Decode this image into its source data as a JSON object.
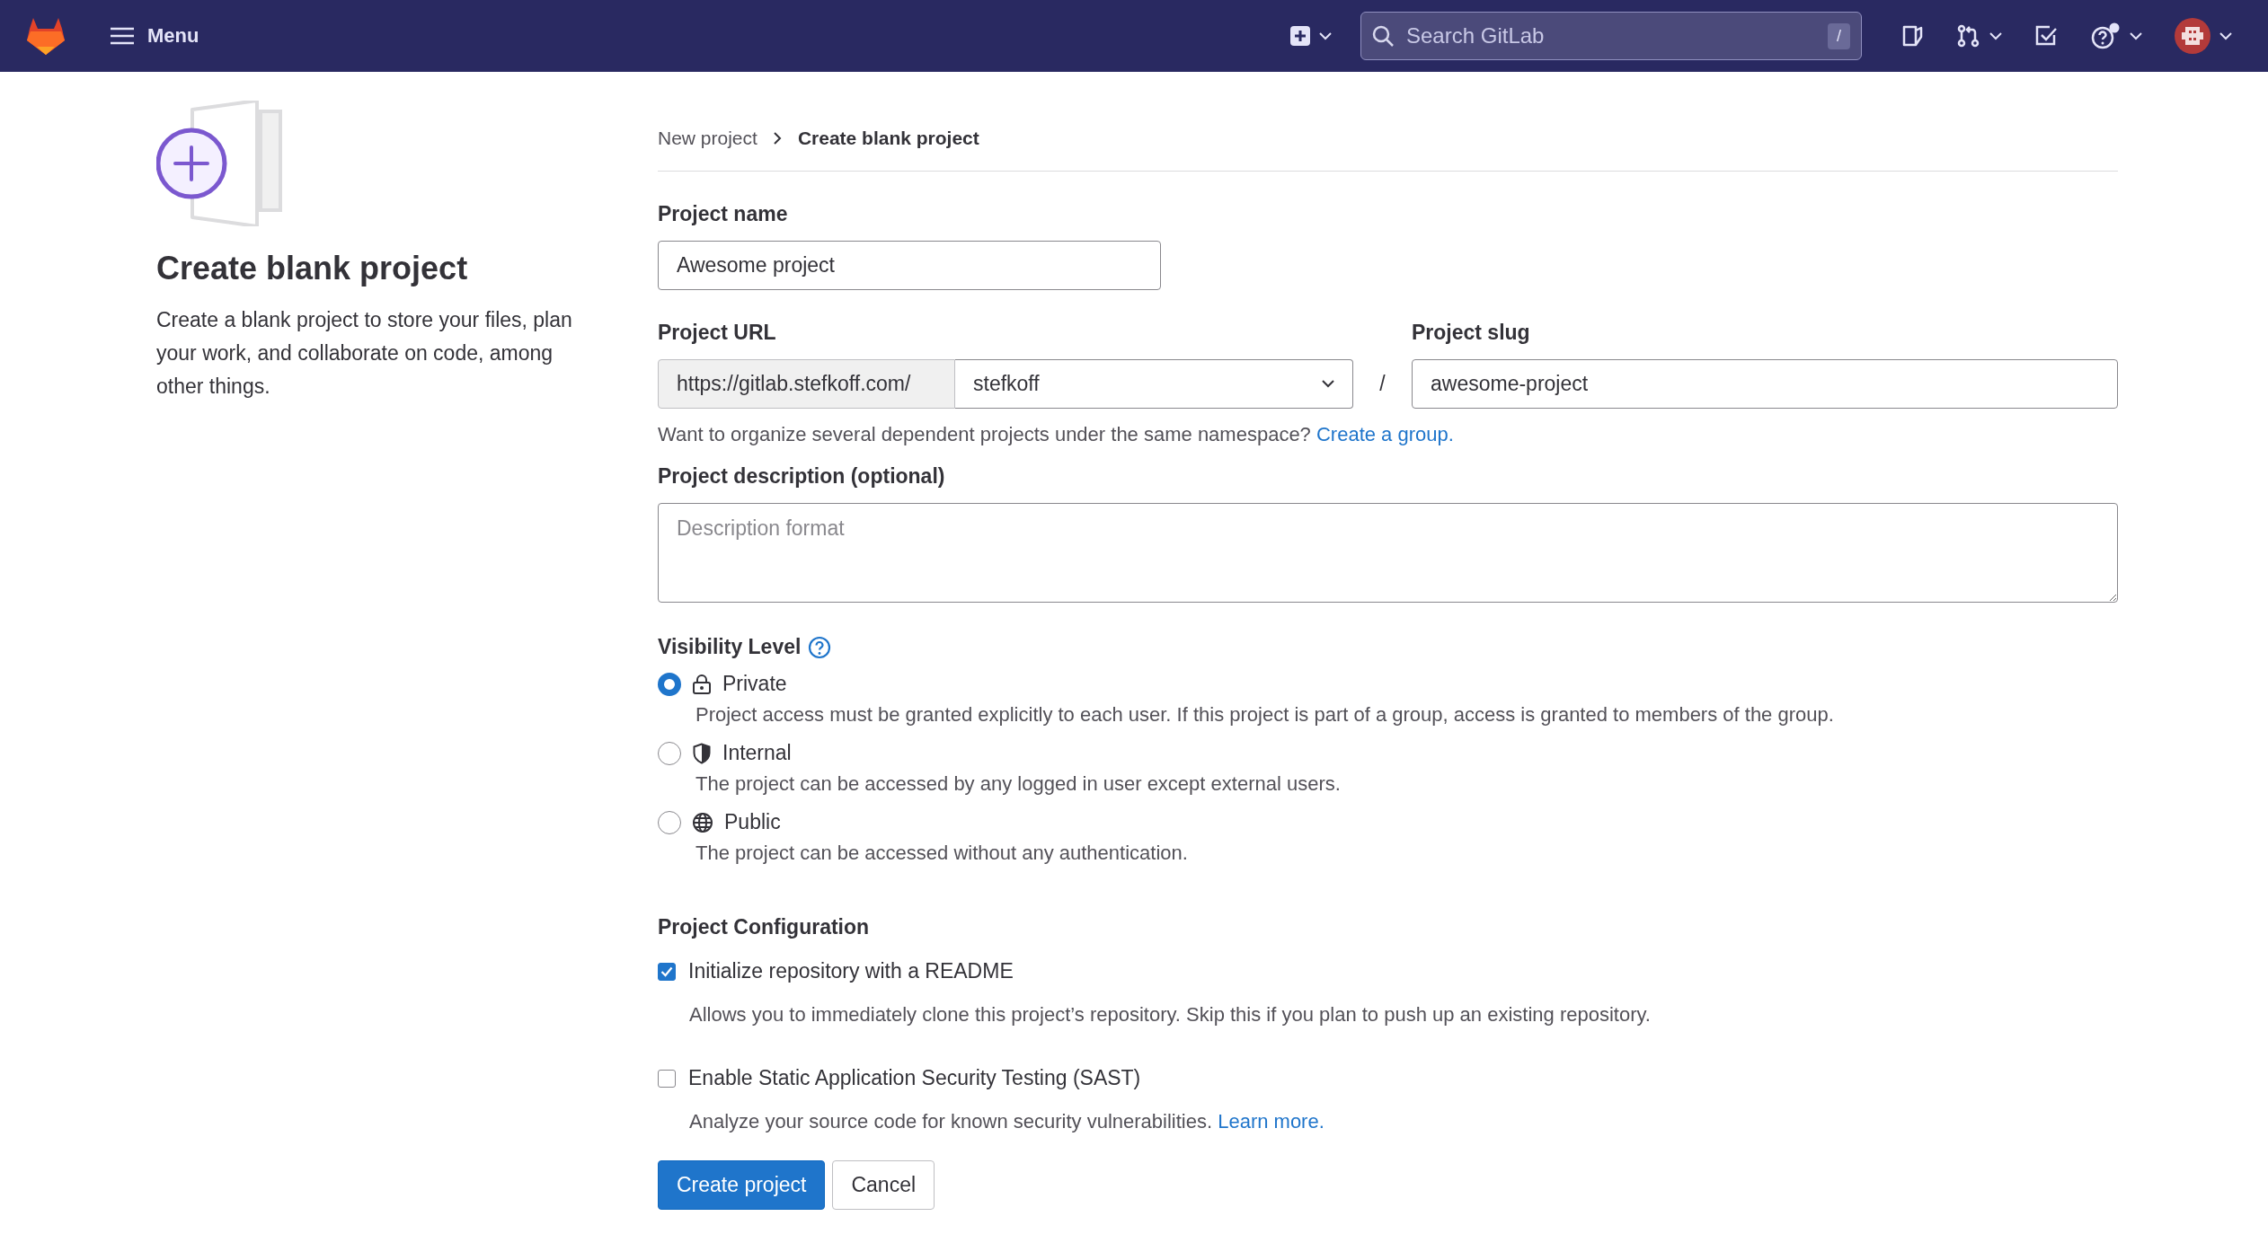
{
  "topbar": {
    "menu_label": "Menu",
    "search": {
      "placeholder": "Search GitLab",
      "shortcut": "/"
    }
  },
  "sidebar": {
    "title": "Create blank project",
    "description": "Create a blank project to store your files, plan your work, and collaborate on code, among other things."
  },
  "breadcrumb": [
    {
      "label": "New project",
      "current": false
    },
    {
      "label": "Create blank project",
      "current": true
    }
  ],
  "project_name": {
    "label": "Project name",
    "value": "Awesome project"
  },
  "project_url": {
    "label": "Project URL",
    "prefix": "https://gitlab.stefkoff.com/",
    "namespace": "stefkoff",
    "separator": "/"
  },
  "project_slug": {
    "label": "Project slug",
    "value": "awesome-project"
  },
  "namespace_help": {
    "text": "Want to organize several dependent projects under the same namespace? ",
    "link": "Create a group."
  },
  "description": {
    "label": "Project description (optional)",
    "placeholder": "Description format"
  },
  "visibility": {
    "label": "Visibility Level",
    "options": [
      {
        "kind": "lock",
        "label": "Private",
        "description": "Project access must be granted explicitly to each user. If this project is part of a group, access is granted to members of the group.",
        "selected": true
      },
      {
        "kind": "shield",
        "label": "Internal",
        "description": "The project can be accessed by any logged in user except external users.",
        "selected": false
      },
      {
        "kind": "globe",
        "label": "Public",
        "description": "The project can be accessed without any authentication.",
        "selected": false
      }
    ]
  },
  "configuration": {
    "title": "Project Configuration",
    "options": [
      {
        "label": "Initialize repository with a README",
        "checked": true,
        "description": "Allows you to immediately clone this project’s repository. Skip this if you plan to push up an existing repository."
      },
      {
        "label": "Enable Static Application Security Testing (SAST)",
        "checked": false,
        "description": "Analyze your source code for known security vulnerabilities. ",
        "link": "Learn more."
      }
    ]
  },
  "buttons": [
    {
      "label": "Create project",
      "kind": "primary"
    },
    {
      "label": "Cancel",
      "kind": "default"
    }
  ]
}
